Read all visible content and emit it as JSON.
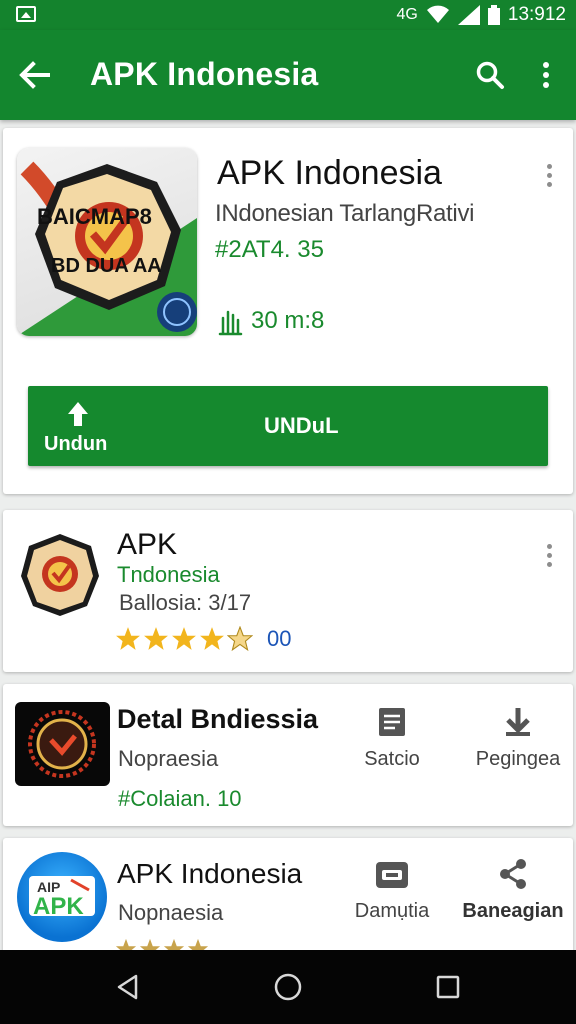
{
  "status_bar": {
    "network": "4G",
    "time": "13:912"
  },
  "app_bar": {
    "title": "APK Indonesia"
  },
  "featured": {
    "title": "APK Indonesia",
    "subtitle": "INdonesian TarlangRativi",
    "code": "#2AT4. 35",
    "size": "30 m:8",
    "icon_text_top": "BAICMAP8",
    "icon_text_bottom": "BD DUA AA",
    "download_small_label": "Undun",
    "download_label": "UNDuL"
  },
  "list": [
    {
      "title": "APK",
      "subtitle": "Tndonesia",
      "meta": "Ballosia: 3/17",
      "rating": 4.5,
      "rating_count": "00"
    },
    {
      "title": "Detal Bndiessia",
      "subtitle": "Nopraesia",
      "code": "#Colaian. 10",
      "actions": [
        "Satcio",
        "Pegingea"
      ]
    },
    {
      "title": "APK Indonesia",
      "subtitle": "Nopnaesia",
      "icon_text_top": "AIP",
      "icon_text_bottom": "APK",
      "actions": [
        "Damụtia",
        "Baneagian"
      ]
    }
  ],
  "colors": {
    "primary": "#13862e",
    "accent_text": "#1a8a2e",
    "star": "#f2b51d",
    "count": "#1c55b7"
  }
}
